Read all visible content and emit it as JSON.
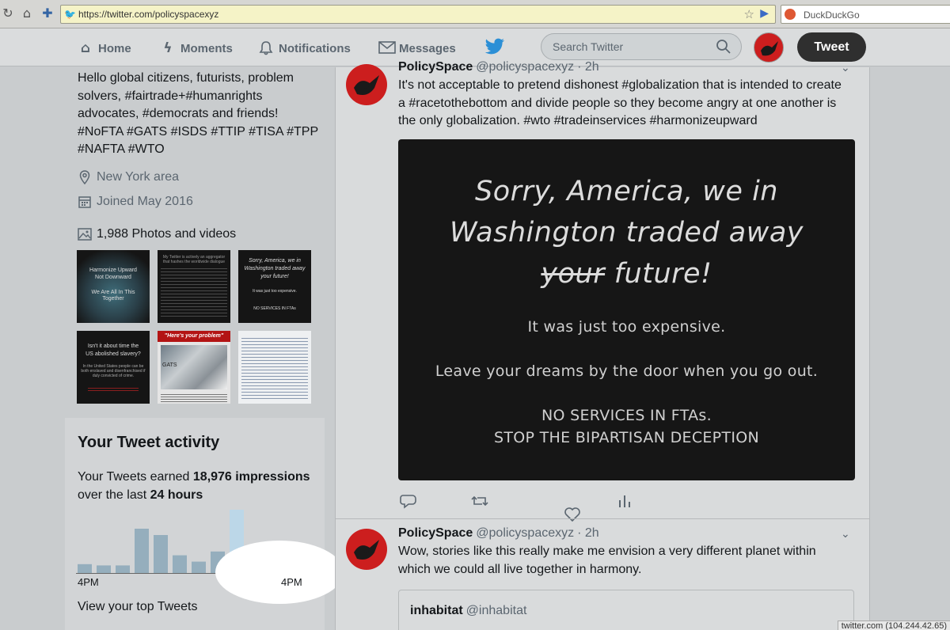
{
  "browser": {
    "url": "https://twitter.com/policyspacexyz",
    "search_engine": "DuckDuckGo",
    "icons": [
      "reload-icon",
      "home-icon",
      "new-tab-icon",
      "twitter-favicon",
      "bookmark-star-icon",
      "go-arrow-icon",
      "duckduckgo-icon"
    ]
  },
  "nav": {
    "home": "Home",
    "moments": "Moments",
    "notifications": "Notifications",
    "messages": "Messages",
    "search_placeholder": "Search Twitter",
    "tweet_button": "Tweet"
  },
  "profile": {
    "bio": "Hello global citizens, futurists, problem solvers, #fairtrade+#humanrights advocates, #democrats and friends! #NoFTA #GATS #ISDS #TTIP #TISA #TPP #NAFTA #WTO",
    "location": "New York area",
    "joined": "Joined May 2016",
    "photos": "1,988 Photos and videos",
    "thumbs": [
      {
        "lines": [
          "Harmonize Upward",
          "Not Downward",
          "We Are All In This Together"
        ]
      },
      {
        "lines": [
          "My Twitter is actively an aggregator that hashes the worldwide dialogue"
        ]
      },
      {
        "lines": [
          "Sorry, America, we in",
          "Washington traded away",
          "your future!",
          "It was just too expensive.",
          "NO SERVICES IN FTAs"
        ]
      },
      {
        "lines": [
          "Isn't it about time the",
          "US abolished slavery?",
          "In the United States people can be both enslaved and disenfranchised if duly convicted of crime."
        ]
      },
      {
        "lines": [
          "\"Here's your problem\"",
          "GATS"
        ]
      },
      {
        "lines": []
      }
    ]
  },
  "activity": {
    "title": "Your Tweet activity",
    "desc_prefix": "Your Tweets earned ",
    "impressions_count": "18,976",
    "impressions_word": "impressions",
    "desc_mid": " over the last ",
    "period": "24 hours",
    "label_left": "4PM",
    "label_right": "4PM",
    "link": "View your top Tweets",
    "bars": [
      0.14,
      0.12,
      0.12,
      0.7,
      0.6,
      0.28,
      0.18,
      0.34,
      1.0,
      0.04,
      0.04,
      0.04
    ],
    "bar_color": "#95aebd",
    "highlight_color": "#bcd7e8"
  },
  "tweets": [
    {
      "name": "PolicySpace",
      "handle": "@policyspacexyz",
      "time": "· 2h",
      "text": "It's not acceptable to pretend dishonest #globalization that is intended to create a #racetothebottom and divide people so they become angry at one another is the only globalization.  #wto #tradeinservices #harmonizeupward",
      "image": {
        "line1": "Sorry, America, we in",
        "line2": "Washington traded away",
        "line3_strike": "your",
        "line3_rest": " future!",
        "line4": "It was just too expensive.",
        "line5": "Leave your dreams by the door when you go out.",
        "line6": "NO SERVICES IN FTAs.",
        "line7": "STOP THE BIPARTISAN DECEPTION"
      },
      "actions": [
        "reply-icon",
        "retweet-icon",
        "like-icon",
        "analytics-icon"
      ]
    },
    {
      "name": "PolicySpace",
      "handle": "@policyspacexyz",
      "time": "· 2h",
      "text": "Wow, stories like this really make me envision a very different planet within which we could all live together in harmony.",
      "quote": {
        "name": "inhabitat",
        "handle": "@inhabitat"
      }
    }
  ],
  "status": "twitter.com (104.244.42.65)"
}
